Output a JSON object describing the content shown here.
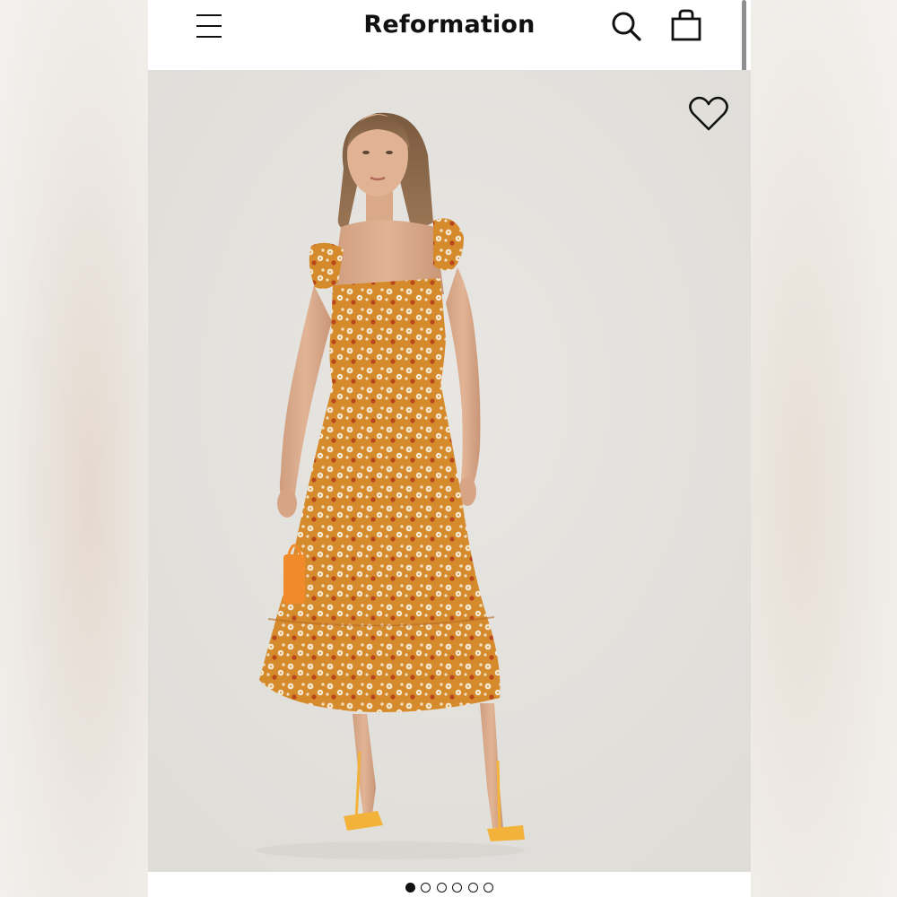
{
  "header": {
    "brand": "Reformation",
    "menu_icon": "menu-icon",
    "search_icon": "search-icon",
    "bag_icon": "shopping-bag-icon"
  },
  "product": {
    "image_description_icon": "product-photo",
    "favorite_icon": "heart-icon",
    "dress_color": "#d9912f",
    "background_color": "#e5e3df"
  },
  "carousel": {
    "total_images": 6,
    "active_index": 0
  }
}
